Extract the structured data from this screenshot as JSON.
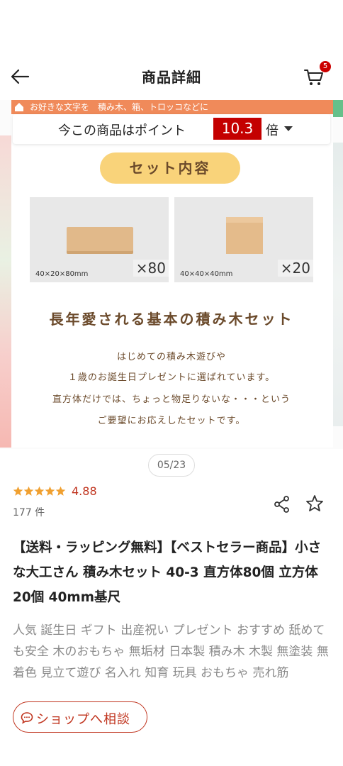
{
  "header": {
    "title": "商品詳細",
    "cart_count": "5"
  },
  "banner": {
    "text": "お好きな文字を　積み木、箱、トロッコなどに"
  },
  "points": {
    "prefix": "今この商品はポイント",
    "value": "10.3",
    "suffix": "倍"
  },
  "product_image": {
    "set_label": "セット内容",
    "blocks": [
      {
        "dimensions": "40×20×80mm",
        "count": "×80"
      },
      {
        "dimensions": "40×40×40mm",
        "count": "×20"
      }
    ],
    "headline": "長年愛される基本の積み木セット",
    "description": [
      "はじめての積み木遊びや",
      "１歳のお誕生日プレゼントに選ばれています。",
      "直方体だけでは、ちょっと物足りないな・・・という",
      "ご要望にお応えしたセットです。"
    ]
  },
  "pager": {
    "label": "05/23"
  },
  "rating": {
    "score": "4.88",
    "stars": 5,
    "review_count": "177 件",
    "star_color": "#f0a030"
  },
  "product": {
    "title": "【送料・ラッピング無料】【ベストセラー商品】小さな大工さん 積み木セット 40-3 直方体80個 立方体20個 40mm基尺",
    "tags": "人気 誕生日 ギフト 出産祝い プレゼント おすすめ 舐めても安全 木のおもちゃ 無垢材 日本製  積み木 木製 無塗装 無着色 見立て遊び 名入れ 知育 玩具 おもちゃ 売れ筋"
  },
  "shop_button": {
    "label": "ショップへ相談"
  },
  "colors": {
    "accent": "#c0341e",
    "points_badge": "#c40000",
    "pill": "#f9d37a",
    "brown_text": "#6b4a2b"
  }
}
